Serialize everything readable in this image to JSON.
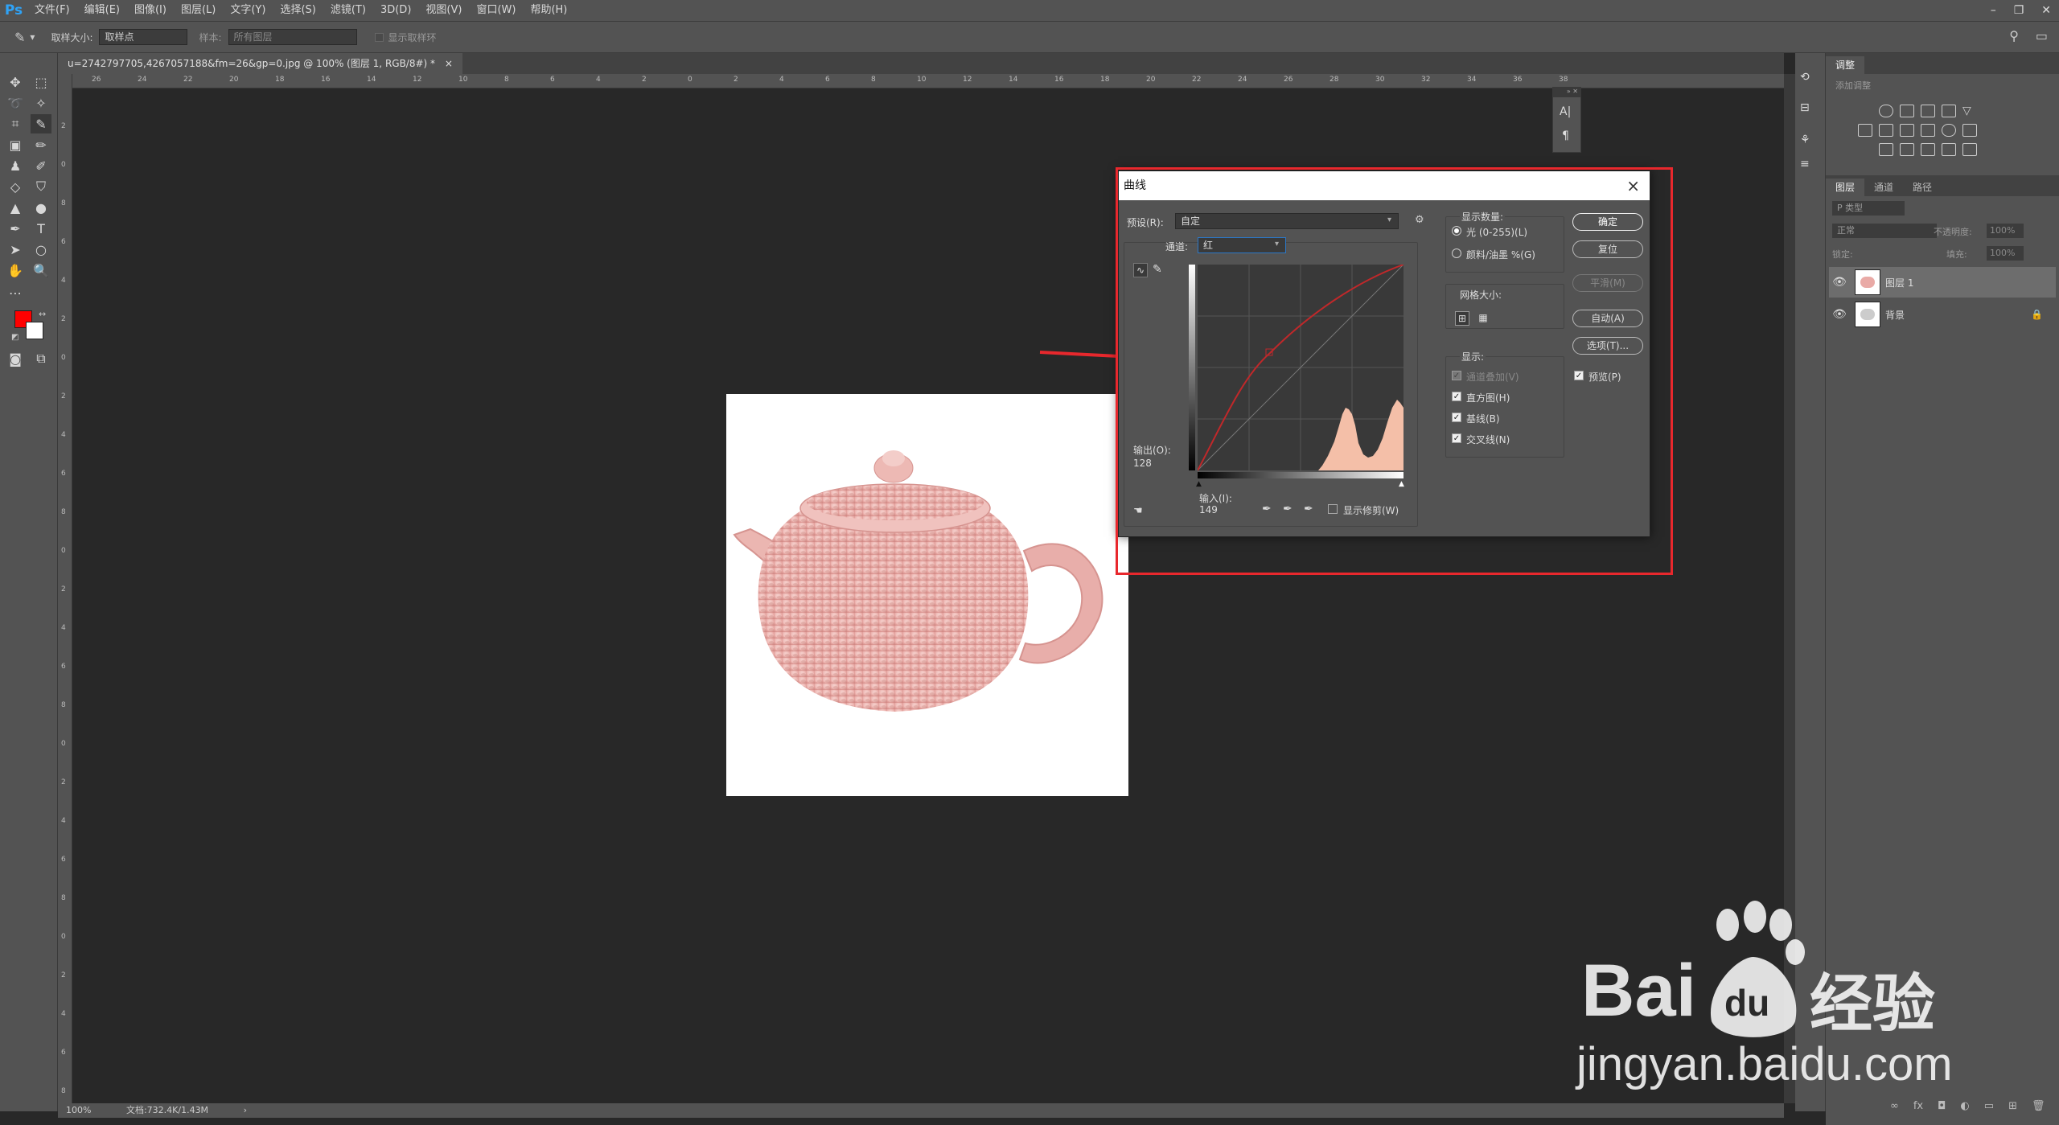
{
  "app": {
    "logo": "Ps"
  },
  "menu": [
    "文件(F)",
    "编辑(E)",
    "图像(I)",
    "图层(L)",
    "文字(Y)",
    "选择(S)",
    "滤镜(T)",
    "3D(D)",
    "视图(V)",
    "窗口(W)",
    "帮助(H)"
  ],
  "options": {
    "sample_size_label": "取样大小:",
    "sample_size_value": "取样点",
    "sample_label": "样本:",
    "sample_value": "所有图层",
    "show_ring": "显示取样环"
  },
  "document": {
    "tab_title": "u=2742797705,4267057188&fm=26&gp=0.jpg @ 100% (图层 1, RGB/8#) *",
    "tab_close": "×",
    "zoom": "100%",
    "doc_size": "文档:732.4K/1.43M"
  },
  "ruler_h_ticks": [
    "26",
    "24",
    "22",
    "20",
    "18",
    "16",
    "14",
    "12",
    "10",
    "8",
    "6",
    "4",
    "2",
    "0",
    "2",
    "4",
    "6",
    "8",
    "10",
    "12",
    "14",
    "16",
    "18",
    "20",
    "22",
    "24",
    "26",
    "28",
    "30",
    "32",
    "34",
    "36",
    "38"
  ],
  "ruler_v_ticks": [
    "2",
    "0",
    "8",
    "6",
    "4",
    "2",
    "0",
    "2",
    "4",
    "6",
    "8",
    "0",
    "2",
    "4",
    "6",
    "8",
    "0",
    "2",
    "4",
    "6",
    "8",
    "0",
    "2",
    "4",
    "6",
    "8"
  ],
  "right_panel": {
    "tab_adjust": "调整",
    "add_adjust": "添加调整",
    "tab_layers": "图层",
    "tab_channels": "通道",
    "tab_paths": "路径",
    "search_kind": "P 类型",
    "blend_mode": "正常",
    "opacity_label": "不透明度:",
    "opacity_value": "100%",
    "lock_label": "锁定:",
    "fill_label": "填充:",
    "fill_value": "100%",
    "layers": [
      {
        "name": "图层 1",
        "selected": true
      },
      {
        "name": "背景",
        "locked": true
      }
    ]
  },
  "dialog": {
    "title": "曲线",
    "close": "×",
    "preset_label": "预设(R):",
    "preset_value": "自定",
    "channel_label": "通道:",
    "channel_value": "红",
    "output_label": "输出(O):",
    "output_value": "128",
    "input_label": "输入(I):",
    "input_value": "149",
    "show_clipping": "显示修剪(W)",
    "show_amount_label": "显示数量:",
    "light_option": "光 (0-255)(L)",
    "pigment_option": "颜料/油墨 %(G)",
    "grid_size_label": "网格大小:",
    "show_label": "显示:",
    "show_channel_overlay": "通道叠加(V)",
    "show_histogram": "直方图(H)",
    "show_baseline": "基线(B)",
    "show_intersection": "交叉线(N)",
    "ok": "确定",
    "reset": "复位",
    "smooth": "平滑(M)",
    "auto": "自动(A)",
    "options": "选项(T)...",
    "preview": "预览(P)",
    "curve_color": "#c0282a",
    "histogram_color": "#f4bfa8"
  },
  "watermark": {
    "brand": "Bai",
    "du": "du",
    "cn": "经验",
    "url": "jingyan.baidu.com"
  },
  "colors": {
    "foreground": "#ff0000",
    "background": "#ffffff",
    "highlight": "#e8282d",
    "arrow": "#e8282d"
  }
}
